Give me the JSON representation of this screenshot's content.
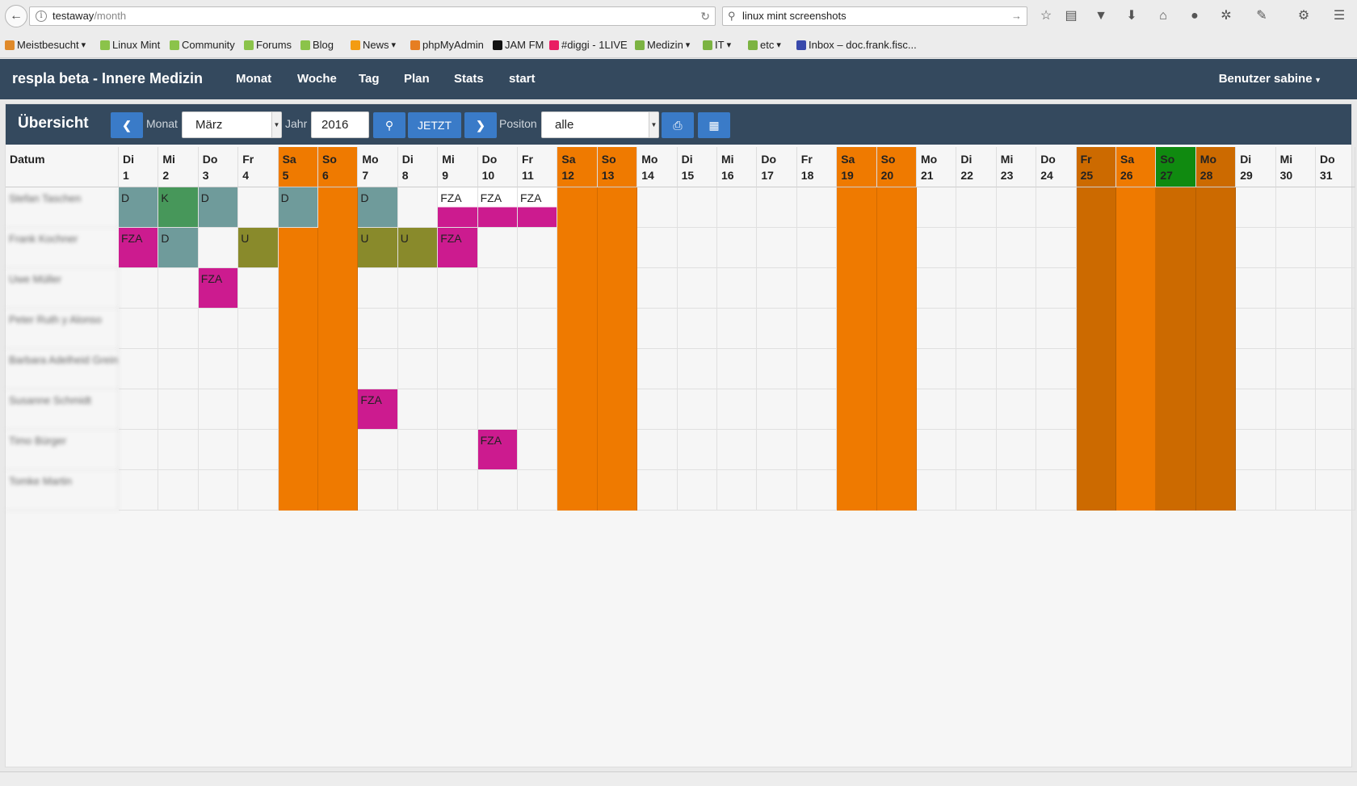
{
  "browser": {
    "url_host": "testaway",
    "url_path": "/month",
    "search_text": "linux mint screenshots",
    "bookmarks": [
      {
        "label": "Meistbesucht",
        "dropdown": true,
        "color": "#e08a2a"
      },
      {
        "label": "Linux Mint",
        "dropdown": false,
        "color": "#8bc34a"
      },
      {
        "label": "Community",
        "dropdown": false,
        "color": "#8bc34a"
      },
      {
        "label": "Forums",
        "dropdown": false,
        "color": "#8bc34a"
      },
      {
        "label": "Blog",
        "dropdown": false,
        "color": "#8bc34a"
      },
      {
        "label": "News",
        "dropdown": true,
        "color": "#f39c12"
      },
      {
        "label": "phpMyAdmin",
        "dropdown": false,
        "color": "#e67e22"
      },
      {
        "label": "JAM FM",
        "dropdown": false,
        "color": "#111111"
      },
      {
        "label": "#diggi - 1LIVE",
        "dropdown": false,
        "color": "#e91e63"
      },
      {
        "label": "Medizin",
        "dropdown": true,
        "color": "#7cb342"
      },
      {
        "label": "IT",
        "dropdown": true,
        "color": "#7cb342"
      },
      {
        "label": "etc",
        "dropdown": true,
        "color": "#7cb342"
      },
      {
        "label": "Inbox – doc.frank.fisc...",
        "dropdown": false,
        "color": "#3949ab"
      }
    ]
  },
  "navbar": {
    "brand": "respla beta - Innere Medizin",
    "links": [
      "Monat",
      "Woche",
      "Tag",
      "Plan",
      "Stats",
      "start"
    ],
    "user_menu": "Benutzer sabine"
  },
  "toolbar": {
    "title": "Übersicht",
    "month_label": "Monat",
    "month_value": "März",
    "year_label": "Jahr",
    "year_value": "2016",
    "now_label": "JETZT",
    "position_label": "Positon",
    "position_value": "alle"
  },
  "grid": {
    "header_label": "Datum",
    "days": [
      {
        "wd": "Di",
        "d": "1",
        "type": "normal"
      },
      {
        "wd": "Mi",
        "d": "2",
        "type": "normal"
      },
      {
        "wd": "Do",
        "d": "3",
        "type": "normal"
      },
      {
        "wd": "Fr",
        "d": "4",
        "type": "normal"
      },
      {
        "wd": "Sa",
        "d": "5",
        "type": "weekend"
      },
      {
        "wd": "So",
        "d": "6",
        "type": "weekend"
      },
      {
        "wd": "Mo",
        "d": "7",
        "type": "normal"
      },
      {
        "wd": "Di",
        "d": "8",
        "type": "normal"
      },
      {
        "wd": "Mi",
        "d": "9",
        "type": "normal"
      },
      {
        "wd": "Do",
        "d": "10",
        "type": "normal"
      },
      {
        "wd": "Fr",
        "d": "11",
        "type": "normal"
      },
      {
        "wd": "Sa",
        "d": "12",
        "type": "weekend"
      },
      {
        "wd": "So",
        "d": "13",
        "type": "weekend"
      },
      {
        "wd": "Mo",
        "d": "14",
        "type": "normal"
      },
      {
        "wd": "Di",
        "d": "15",
        "type": "normal"
      },
      {
        "wd": "Mi",
        "d": "16",
        "type": "normal"
      },
      {
        "wd": "Do",
        "d": "17",
        "type": "normal"
      },
      {
        "wd": "Fr",
        "d": "18",
        "type": "normal"
      },
      {
        "wd": "Sa",
        "d": "19",
        "type": "weekend"
      },
      {
        "wd": "So",
        "d": "20",
        "type": "weekend"
      },
      {
        "wd": "Mo",
        "d": "21",
        "type": "normal"
      },
      {
        "wd": "Di",
        "d": "22",
        "type": "normal"
      },
      {
        "wd": "Mi",
        "d": "23",
        "type": "normal"
      },
      {
        "wd": "Do",
        "d": "24",
        "type": "normal"
      },
      {
        "wd": "Fr",
        "d": "25",
        "type": "holiday"
      },
      {
        "wd": "Sa",
        "d": "26",
        "type": "weekend"
      },
      {
        "wd": "So",
        "d": "27",
        "type": "today"
      },
      {
        "wd": "Mo",
        "d": "28",
        "type": "holiday"
      },
      {
        "wd": "Di",
        "d": "29",
        "type": "normal"
      },
      {
        "wd": "Mi",
        "d": "30",
        "type": "normal"
      },
      {
        "wd": "Do",
        "d": "31",
        "type": "normal"
      }
    ],
    "rows": [
      {
        "name": "Stefan Taschen",
        "entries": [
          {
            "day": 1,
            "code": "D",
            "kind": "D"
          },
          {
            "day": 2,
            "code": "K",
            "kind": "K"
          },
          {
            "day": 3,
            "code": "D",
            "kind": "D"
          },
          {
            "day": 5,
            "code": "D",
            "kind": "D"
          },
          {
            "day": 7,
            "code": "D",
            "kind": "D"
          },
          {
            "day": 9,
            "code": "FZA",
            "kind": "FZA_HALF"
          },
          {
            "day": 10,
            "code": "FZA",
            "kind": "FZA_HALF"
          },
          {
            "day": 11,
            "code": "FZA",
            "kind": "FZA_HALF"
          }
        ]
      },
      {
        "name": "Frank Kochner",
        "entries": [
          {
            "day": 1,
            "code": "FZA",
            "kind": "FZA"
          },
          {
            "day": 2,
            "code": "D",
            "kind": "D"
          },
          {
            "day": 4,
            "code": "U",
            "kind": "U"
          },
          {
            "day": 7,
            "code": "U",
            "kind": "U"
          },
          {
            "day": 8,
            "code": "U",
            "kind": "U"
          },
          {
            "day": 9,
            "code": "FZA",
            "kind": "FZA"
          }
        ]
      },
      {
        "name": "Uwe Müller",
        "entries": [
          {
            "day": 3,
            "code": "FZA",
            "kind": "FZA"
          }
        ]
      },
      {
        "name": "Peter Ruth y Alonso",
        "entries": []
      },
      {
        "name": "Barbara Adelheid Greiner S",
        "entries": []
      },
      {
        "name": "Susanne Schmidt",
        "entries": [
          {
            "day": 7,
            "code": "FZA",
            "kind": "FZA"
          }
        ]
      },
      {
        "name": "Timo Bürger",
        "entries": [
          {
            "day": 10,
            "code": "FZA",
            "kind": "FZA"
          }
        ]
      },
      {
        "name": "Tomke Martin",
        "entries": []
      }
    ]
  },
  "colors": {
    "weekend": "#ef7a00",
    "holiday": "#cc6a00",
    "today": "#108a10",
    "D": "#6f9b9b",
    "K": "#47975a",
    "U": "#898a2b",
    "FZA": "#cc1b8f"
  }
}
